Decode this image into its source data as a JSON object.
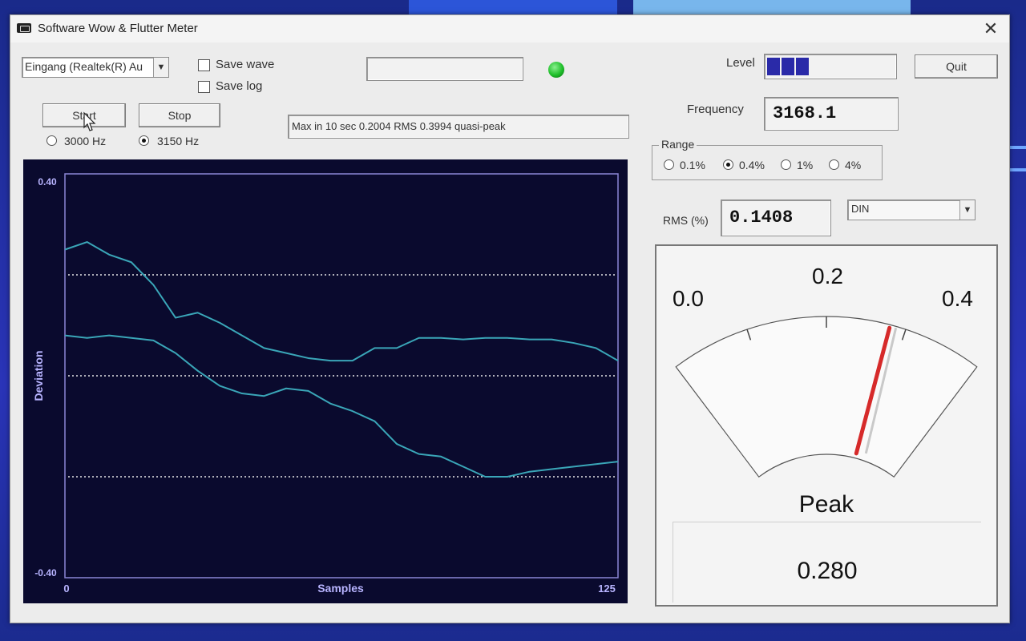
{
  "window": {
    "title": "Software Wow & Flutter Meter",
    "close_glyph": "✕"
  },
  "controls": {
    "input_device": "Eingang (Realtek(R) Au",
    "save_wave_label": "Save wave",
    "save_log_label": "Save log",
    "start_label": "Start",
    "stop_label": "Stop",
    "freq_3000_label": "3000 Hz",
    "freq_3150_label": "3150 Hz",
    "selected_frequency": "3150 Hz",
    "status_message": "Max in 10 sec 0.2004 RMS 0.3994 quasi-peak",
    "status_led_color": "#1fbf2a",
    "level_label": "Level",
    "level_segments_filled": 3,
    "quit_label": "Quit",
    "frequency_label": "Frequency",
    "frequency_value": "3168.1",
    "range_label": "Range",
    "range_options": [
      "0.1%",
      "0.4%",
      "1%",
      "4%"
    ],
    "range_selected": "0.4%",
    "rms_label": "RMS (%)",
    "rms_value": "0.1408",
    "weighting": "DIN"
  },
  "chart_data": {
    "type": "line",
    "ylabel": "Deviation",
    "xlabel": "Samples",
    "xlim": [
      0,
      125
    ],
    "ylim": [
      -0.4,
      0.4
    ],
    "y_top_label": "0.40",
    "y_bottom_label": "-0.40",
    "x_left_label": "0",
    "x_right_label": "125",
    "reference_lines": [
      0.2,
      0.0,
      -0.2
    ],
    "line_color": "#3aa6b8",
    "series": [
      {
        "x": [
          0,
          5,
          10,
          15,
          20,
          25,
          30,
          35,
          40,
          45,
          50,
          55,
          60,
          65,
          70,
          75,
          80,
          85,
          90,
          95,
          100,
          105,
          110,
          115,
          120,
          125
        ],
        "y": [
          0.25,
          0.265,
          0.24,
          0.225,
          0.18,
          0.115,
          0.125,
          0.105,
          0.08,
          0.055,
          0.045,
          0.035,
          0.03,
          0.03,
          0.055,
          0.055,
          0.075,
          0.075,
          0.072,
          0.075,
          0.075,
          0.072,
          0.072,
          0.065,
          0.055,
          0.03
        ]
      },
      {
        "x": [
          0,
          5,
          10,
          15,
          20,
          25,
          30,
          35,
          40,
          45,
          50,
          55,
          60,
          65,
          70,
          75,
          80,
          85,
          90,
          95,
          100,
          105,
          110,
          115,
          120,
          125
        ],
        "y": [
          0.08,
          0.075,
          0.08,
          0.075,
          0.07,
          0.045,
          0.01,
          -0.02,
          -0.035,
          -0.04,
          -0.025,
          -0.03,
          -0.055,
          -0.07,
          -0.09,
          -0.135,
          -0.155,
          -0.16,
          -0.18,
          -0.2,
          -0.2,
          -0.19,
          -0.185,
          -0.18,
          -0.175,
          -0.17
        ]
      }
    ]
  },
  "meter": {
    "scale_labels": [
      "0.0",
      "0.2",
      "0.4"
    ],
    "needle_value": 0.28,
    "needle_color": "#d62a2a",
    "mode_label": "Peak",
    "peak_value": "0.280"
  }
}
